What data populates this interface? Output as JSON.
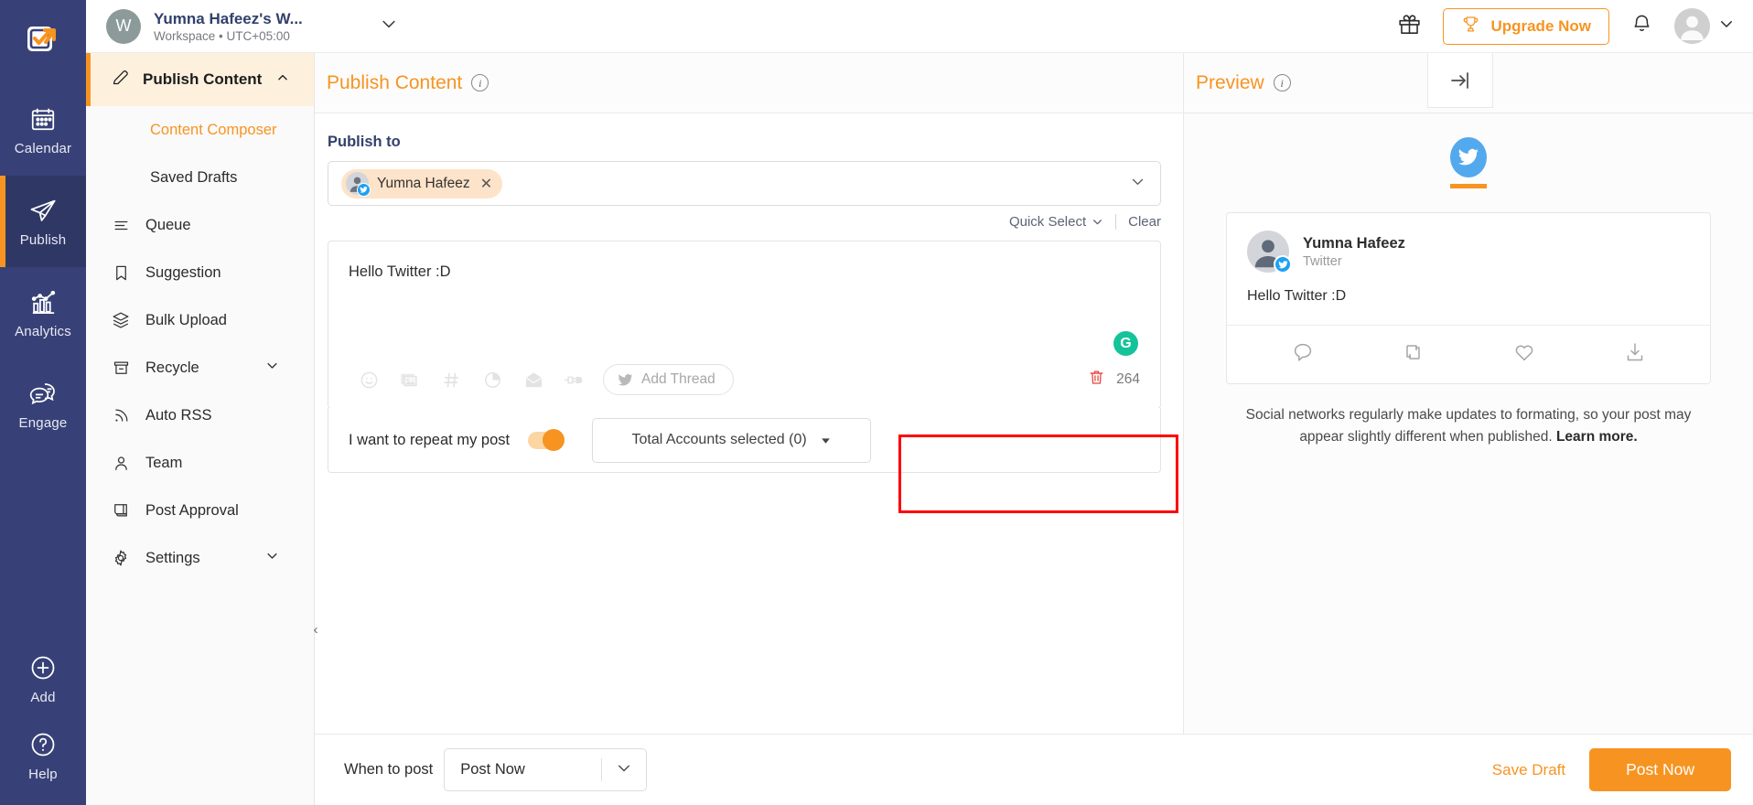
{
  "topbar": {
    "workspace_initial": "W",
    "workspace_title": "Yumna Hafeez's W...",
    "workspace_sub": "Workspace • UTC+05:00",
    "gift_icon": "gift-icon",
    "upgrade_label": "Upgrade Now",
    "trophy_icon": "trophy-icon",
    "bell_icon": "bell-icon",
    "avatar_caret_icon": "chevron-down-icon"
  },
  "rail": {
    "logo_icon": "contentstudio-logo",
    "items": [
      {
        "label": "Calendar",
        "icon": "calendar-icon",
        "active": false
      },
      {
        "label": "Publish",
        "icon": "paper-plane-icon",
        "active": true
      },
      {
        "label": "Analytics",
        "icon": "bar-chart-icon",
        "active": false
      },
      {
        "label": "Engage",
        "icon": "chat-bubbles-icon",
        "active": false
      }
    ],
    "bottom_items": [
      {
        "label": "Add",
        "icon": "plus-circle-icon"
      },
      {
        "label": "Help",
        "icon": "question-circle-icon"
      }
    ]
  },
  "sidebar": {
    "header": {
      "label": "Publish Content",
      "icon": "pencil-icon",
      "caret": "chevron-up-icon"
    },
    "sub_items": [
      {
        "label": "Content Composer",
        "selected": true
      },
      {
        "label": "Saved Drafts",
        "selected": false
      }
    ],
    "items": [
      {
        "label": "Queue",
        "icon": "list-icon",
        "caret": ""
      },
      {
        "label": "Suggestion",
        "icon": "bookmark-icon",
        "caret": ""
      },
      {
        "label": "Bulk Upload",
        "icon": "layers-icon",
        "caret": ""
      },
      {
        "label": "Recycle",
        "icon": "archive-icon",
        "caret": "chevron-down-icon"
      },
      {
        "label": "Auto RSS",
        "icon": "rss-icon",
        "caret": ""
      },
      {
        "label": "Team",
        "icon": "user-icon",
        "caret": ""
      },
      {
        "label": "Post Approval",
        "icon": "scroll-icon",
        "caret": ""
      },
      {
        "label": "Settings",
        "icon": "gear-icon",
        "caret": "chevron-down-icon"
      }
    ]
  },
  "composer": {
    "panel_title": "Publish Content",
    "info_icon": "info-icon",
    "publish_to_label": "Publish to",
    "selected_account": {
      "name": "Yumna Hafeez",
      "network": "twitter",
      "remove_icon": "close-icon"
    },
    "dropdown_caret_icon": "chevron-down-icon",
    "quick_select_label": "Quick Select",
    "clear_label": "Clear",
    "editor_text": "Hello Twitter :D",
    "grammarly_badge": "G",
    "toolbar_icons": [
      "emoji-icon",
      "image-icon",
      "hashtag-icon",
      "chart-pie-icon",
      "email-icon",
      "plug-icon"
    ],
    "add_thread_label": "Add Thread",
    "add_thread_icon": "twitter-icon",
    "delete_icon": "trash-icon",
    "char_count": "264",
    "repeat_label": "I want to repeat my post",
    "repeat_toggle_on": true,
    "accounts_select_label": "Total Accounts selected (0)",
    "accounts_caret_icon": "caret-down-icon"
  },
  "preview": {
    "panel_title": "Preview",
    "info_icon": "info-icon",
    "network_tab_icon": "twitter-icon",
    "card": {
      "name": "Yumna Hafeez",
      "network": "Twitter",
      "text": "Hello Twitter :D",
      "actions": [
        "reply-icon",
        "retweet-icon",
        "like-icon",
        "share-icon"
      ]
    },
    "note_text": "Social networks regularly make updates to formating, so your post may appear slightly different when published.",
    "note_link": "Learn more."
  },
  "bottombar": {
    "when_label": "When to post",
    "when_value": "Post Now",
    "when_caret_icon": "chevron-down-icon",
    "save_draft_label": "Save Draft",
    "post_now_label": "Post Now"
  },
  "colors": {
    "accent": "#f79421",
    "rail_bg": "#384177",
    "brand_navy": "#31416b",
    "twitter_blue": "#1da1f2",
    "highlight_red": "#ff0000",
    "grammarly_green": "#15c39a"
  }
}
